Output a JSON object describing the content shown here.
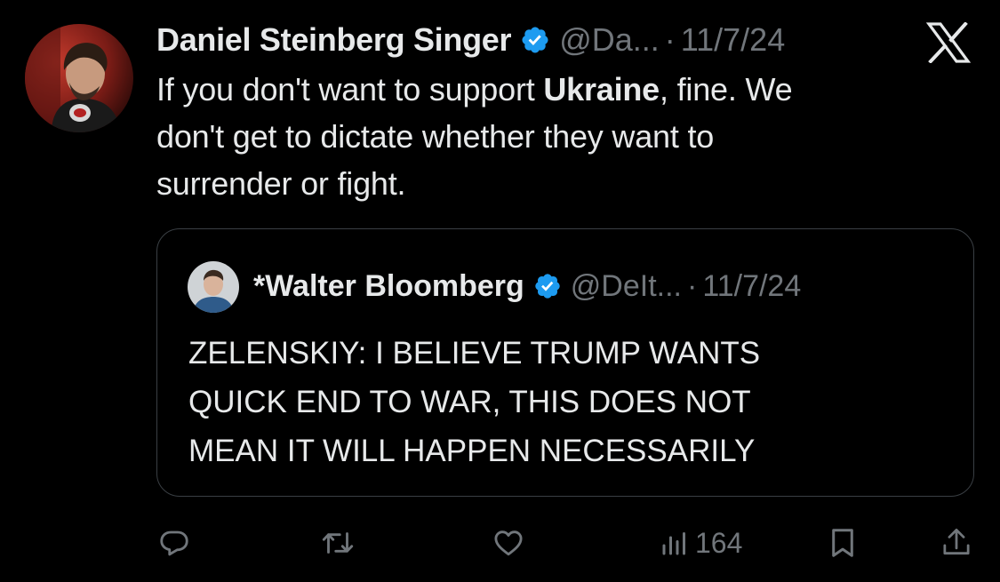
{
  "tweet": {
    "author_name": "Daniel Steinberg Singer",
    "author_handle": "@Da...",
    "dot": "·",
    "date": "11/7/24",
    "text_line1_pre": "If you don't want to support ",
    "text_line1_bold": "Ukraine",
    "text_line1_post": ", fine. We",
    "text_line2": "don't get to dictate whether they want to",
    "text_line3": "surrender or fight."
  },
  "quote": {
    "author_name": "*Walter Bloomberg",
    "author_handle": "@DeIt...",
    "dot": "·",
    "date": "11/7/24",
    "text_line1": "ZELENSKIY: I BELIEVE TRUMP WANTS",
    "text_line2": "QUICK END TO WAR, THIS DOES NOT",
    "text_line3": "MEAN IT WILL HAPPEN NECESSARILY"
  },
  "actions": {
    "views": "164"
  },
  "icons": {
    "verified": "verified-badge-icon",
    "brand": "x-logo-icon",
    "reply": "reply-icon",
    "retweet": "retweet-icon",
    "like": "heart-icon",
    "views": "views-chart-icon",
    "bookmark": "bookmark-icon",
    "share": "share-icon"
  },
  "colors": {
    "background": "#000000",
    "text": "#e7e9ea",
    "secondary": "#71767b",
    "verified": "#1d9bf0",
    "border": "#3a3f44"
  }
}
